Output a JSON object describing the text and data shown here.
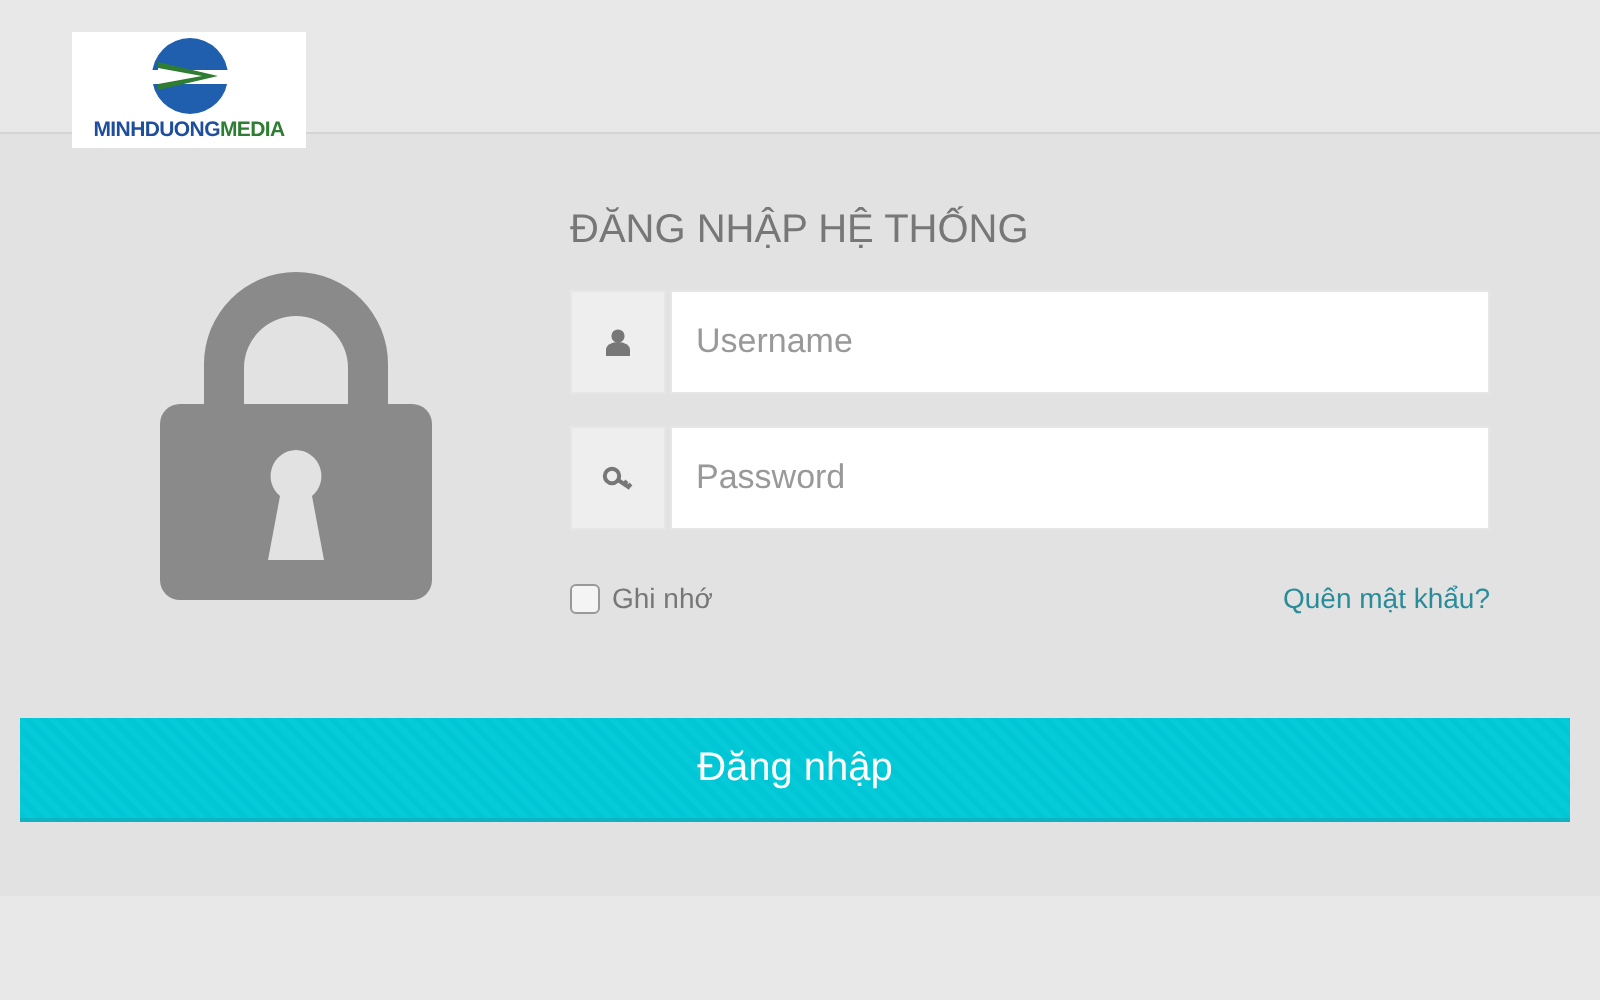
{
  "logo": {
    "parts": [
      {
        "text": "MINHDUONG",
        "color": "#1f4e9c"
      },
      {
        "text": "MEDIA",
        "color": "#2e7d32"
      }
    ]
  },
  "form": {
    "title": "ĐĂNG NHẬP HỆ THỐNG",
    "fields": [
      {
        "kind": "user",
        "placeholder": "Username"
      },
      {
        "kind": "password",
        "placeholder": "Password"
      }
    ],
    "remember": {
      "label": "Ghi nhớ",
      "checked": false
    },
    "forgot_link": "Quên mật khẩu?",
    "submit": "Đăng nhập"
  }
}
